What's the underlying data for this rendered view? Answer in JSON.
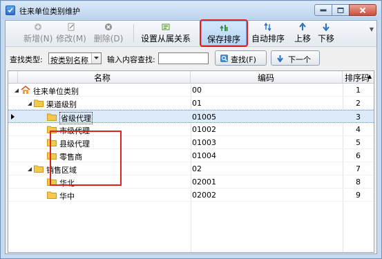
{
  "window": {
    "title": "往来单位类别维护"
  },
  "toolbar": {
    "items": [
      {
        "label": "新增(N)",
        "icon": "plus-circle-icon",
        "disabled": true
      },
      {
        "label": "修改(M)",
        "icon": "edit-icon",
        "disabled": true
      },
      {
        "label": "删除(D)",
        "icon": "delete-icon",
        "disabled": true
      },
      {
        "label": "设置从属关系",
        "icon": "hierarchy-icon",
        "disabled": false
      },
      {
        "label": "保存排序",
        "icon": "save-sort-icon",
        "disabled": false,
        "active": true
      },
      {
        "label": "自动排序",
        "icon": "auto-sort-icon",
        "disabled": false
      },
      {
        "label": "上移",
        "icon": "move-up-icon",
        "disabled": false
      },
      {
        "label": "下移",
        "icon": "move-down-icon",
        "disabled": false
      }
    ],
    "overflow": "▼"
  },
  "search": {
    "type_label": "查找类型:",
    "type_value": "按类别名称",
    "content_label": "输入内容查找:",
    "content_value": "",
    "find_button": "查找(F)",
    "next_button": "下一个"
  },
  "grid": {
    "columns": {
      "name": "名称",
      "code": "编码",
      "sort": "排序码"
    },
    "sort_indicator": "▲",
    "rows": [
      {
        "name": "往来单位类别",
        "code": "00",
        "sort": "1",
        "level": 0,
        "expanded": true,
        "icon": "home-icon"
      },
      {
        "name": "渠道级别",
        "code": "01",
        "sort": "2",
        "level": 1,
        "expanded": true,
        "icon": "folder-icon"
      },
      {
        "name": "省级代理",
        "code": "01005",
        "sort": "3",
        "level": 2,
        "selected": true,
        "icon": "folder-icon"
      },
      {
        "name": "市级代理",
        "code": "01002",
        "sort": "4",
        "level": 2,
        "icon": "folder-icon"
      },
      {
        "name": "县级代理",
        "code": "01003",
        "sort": "5",
        "level": 2,
        "icon": "folder-icon"
      },
      {
        "name": "零售商",
        "code": "01004",
        "sort": "6",
        "level": 2,
        "icon": "folder-icon"
      },
      {
        "name": "销售区域",
        "code": "02",
        "sort": "7",
        "level": 1,
        "expanded": true,
        "icon": "folder-icon"
      },
      {
        "name": "华北",
        "code": "02001",
        "sort": "8",
        "level": 2,
        "icon": "folder-icon"
      },
      {
        "name": "华中",
        "code": "02002",
        "sort": "9",
        "level": 2,
        "icon": "folder-icon"
      }
    ]
  },
  "colors": {
    "highlight": "#e02020",
    "selection": "#dbe9f9",
    "folder": "#f3c84b"
  }
}
